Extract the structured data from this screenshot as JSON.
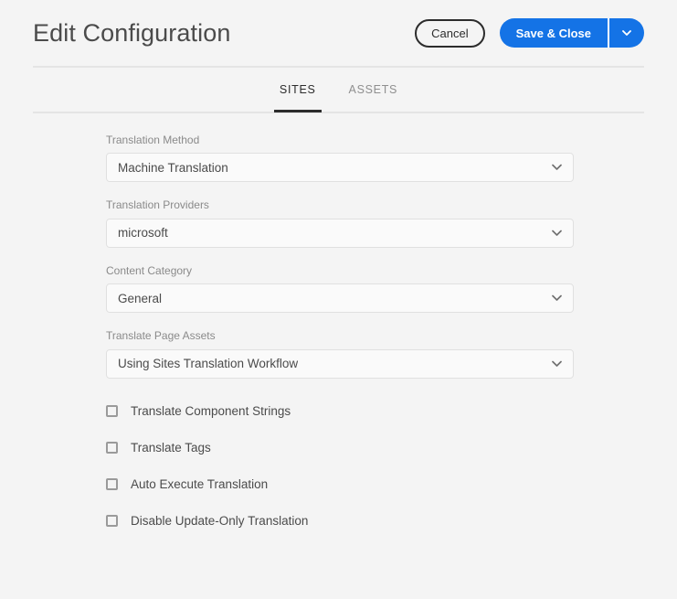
{
  "header": {
    "title": "Edit Configuration",
    "cancel_label": "Cancel",
    "save_label": "Save & Close",
    "split_icon": "chevron-down-icon"
  },
  "tabs": [
    {
      "label": "SITES",
      "active": true
    },
    {
      "label": "ASSETS",
      "active": false
    }
  ],
  "form": {
    "fields": [
      {
        "label": "Translation Method",
        "value": "Machine Translation",
        "icon": "chevron-down-icon"
      },
      {
        "label": "Translation Providers",
        "value": "microsoft",
        "icon": "chevron-down-icon"
      },
      {
        "label": "Content Category",
        "value": "General",
        "icon": "chevron-down-icon"
      },
      {
        "label": "Translate Page Assets",
        "value": "Using Sites Translation Workflow",
        "icon": "chevron-down-icon"
      }
    ],
    "checkboxes": [
      {
        "label": "Translate Component Strings",
        "checked": false
      },
      {
        "label": "Translate Tags",
        "checked": false
      },
      {
        "label": "Auto Execute Translation",
        "checked": false
      },
      {
        "label": "Disable Update-Only Translation",
        "checked": false
      }
    ]
  },
  "colors": {
    "page_background": "#f4f4f4",
    "accent_blue": "#1473e6",
    "text_primary": "#4b4b4b",
    "text_muted": "#8a8a8a",
    "tab_active": "#2c2c2c",
    "border": "#e0e0e0",
    "divider": "#e4e4e4"
  }
}
